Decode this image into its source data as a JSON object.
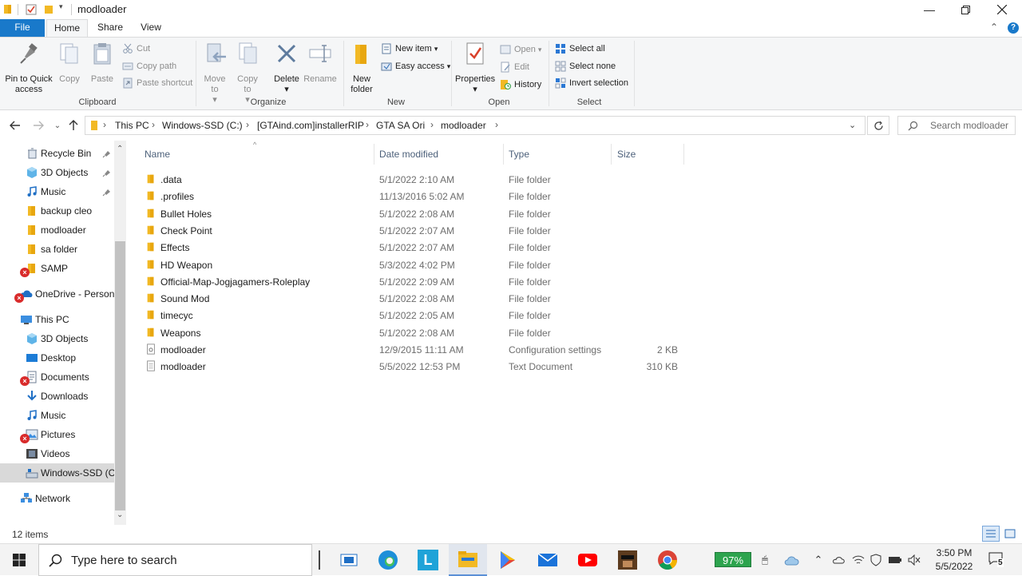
{
  "window": {
    "title": "modloader",
    "controls": [
      "minimize-icon",
      "restore-icon",
      "close-icon"
    ]
  },
  "ribbon_tabs": [
    "File",
    "Home",
    "Share",
    "View"
  ],
  "ribbon": {
    "clipboard": {
      "label": "Clipboard",
      "pin": "Pin to Quick access",
      "copy": "Copy",
      "paste": "Paste",
      "cut": "Cut",
      "copy_path": "Copy path",
      "paste_shortcut": "Paste shortcut"
    },
    "organize": {
      "label": "Organize",
      "move_to": "Move to",
      "copy_to": "Copy to",
      "delete": "Delete",
      "rename": "Rename"
    },
    "new": {
      "label": "New",
      "new_folder": "New folder",
      "new_item": "New item",
      "easy_access": "Easy access"
    },
    "open": {
      "label": "Open",
      "properties": "Properties",
      "open": "Open",
      "edit": "Edit",
      "history": "History"
    },
    "select": {
      "label": "Select",
      "select_all": "Select all",
      "select_none": "Select none",
      "invert": "Invert selection"
    }
  },
  "address": {
    "breadcrumbs": [
      "This PC",
      "Windows-SSD (C:)",
      "[GTAind.com]installerRIP",
      "GTA SA Ori",
      "modloader"
    ],
    "search_placeholder": "Search modloader"
  },
  "nav_pane": [
    {
      "label": "Recycle Bin",
      "icon": "recycle-bin-icon",
      "pinned": true
    },
    {
      "label": "3D Objects",
      "icon": "3d-objects-icon",
      "pinned": true
    },
    {
      "label": "Music",
      "icon": "music-icon",
      "pinned": true
    },
    {
      "label": "backup cleo",
      "icon": "folder-icon"
    },
    {
      "label": "modloader",
      "icon": "folder-icon"
    },
    {
      "label": "sa folder",
      "icon": "folder-icon"
    },
    {
      "label": "SAMP",
      "icon": "folder-icon",
      "error": true
    },
    {
      "label": "OneDrive - Persona",
      "icon": "onedrive-icon",
      "error": true
    },
    {
      "label": "This PC",
      "icon": "pc-icon"
    },
    {
      "label": "3D Objects",
      "icon": "3d-objects-icon"
    },
    {
      "label": "Desktop",
      "icon": "desktop-icon"
    },
    {
      "label": "Documents",
      "icon": "documents-icon",
      "error": true
    },
    {
      "label": "Downloads",
      "icon": "downloads-icon"
    },
    {
      "label": "Music",
      "icon": "music-icon"
    },
    {
      "label": "Pictures",
      "icon": "pictures-icon",
      "error": true
    },
    {
      "label": "Videos",
      "icon": "videos-icon"
    },
    {
      "label": "Windows-SSD (C",
      "icon": "drive-icon",
      "selected": true
    },
    {
      "label": "Network",
      "icon": "network-icon"
    }
  ],
  "columns": [
    "Name",
    "Date modified",
    "Type",
    "Size"
  ],
  "files": [
    {
      "name": ".data",
      "date": "5/1/2022 2:10 AM",
      "type": "File folder",
      "size": "",
      "icon": "folder-icon"
    },
    {
      "name": ".profiles",
      "date": "11/13/2016 5:02 AM",
      "type": "File folder",
      "size": "",
      "icon": "folder-icon"
    },
    {
      "name": "Bullet Holes",
      "date": "5/1/2022 2:08 AM",
      "type": "File folder",
      "size": "",
      "icon": "folder-icon"
    },
    {
      "name": "Check Point",
      "date": "5/1/2022 2:07 AM",
      "type": "File folder",
      "size": "",
      "icon": "folder-icon"
    },
    {
      "name": "Effects",
      "date": "5/1/2022 2:07 AM",
      "type": "File folder",
      "size": "",
      "icon": "folder-icon"
    },
    {
      "name": "HD Weapon",
      "date": "5/3/2022 4:02 PM",
      "type": "File folder",
      "size": "",
      "icon": "folder-icon"
    },
    {
      "name": "Official-Map-Jogjagamers-Roleplay",
      "date": "5/1/2022 2:09 AM",
      "type": "File folder",
      "size": "",
      "icon": "folder-icon"
    },
    {
      "name": "Sound Mod",
      "date": "5/1/2022 2:08 AM",
      "type": "File folder",
      "size": "",
      "icon": "folder-icon"
    },
    {
      "name": "timecyc",
      "date": "5/1/2022 2:05 AM",
      "type": "File folder",
      "size": "",
      "icon": "folder-icon"
    },
    {
      "name": "Weapons",
      "date": "5/1/2022 2:08 AM",
      "type": "File folder",
      "size": "",
      "icon": "folder-icon"
    },
    {
      "name": "modloader",
      "date": "12/9/2015 11:11 AM",
      "type": "Configuration settings",
      "size": "2 KB",
      "icon": "config-file-icon"
    },
    {
      "name": "modloader",
      "date": "5/5/2022 12:53 PM",
      "type": "Text Document",
      "size": "310 KB",
      "icon": "text-file-icon"
    }
  ],
  "status": {
    "item_count": "12 items"
  },
  "taskbar": {
    "search_placeholder": "Type here to search",
    "battery": "97%",
    "time": "3:50 PM",
    "date": "5/5/2022",
    "notifications": "5"
  },
  "colors": {
    "accent": "#1979ca",
    "folder": "#f8c84a",
    "selected": "#d9d9d9"
  }
}
